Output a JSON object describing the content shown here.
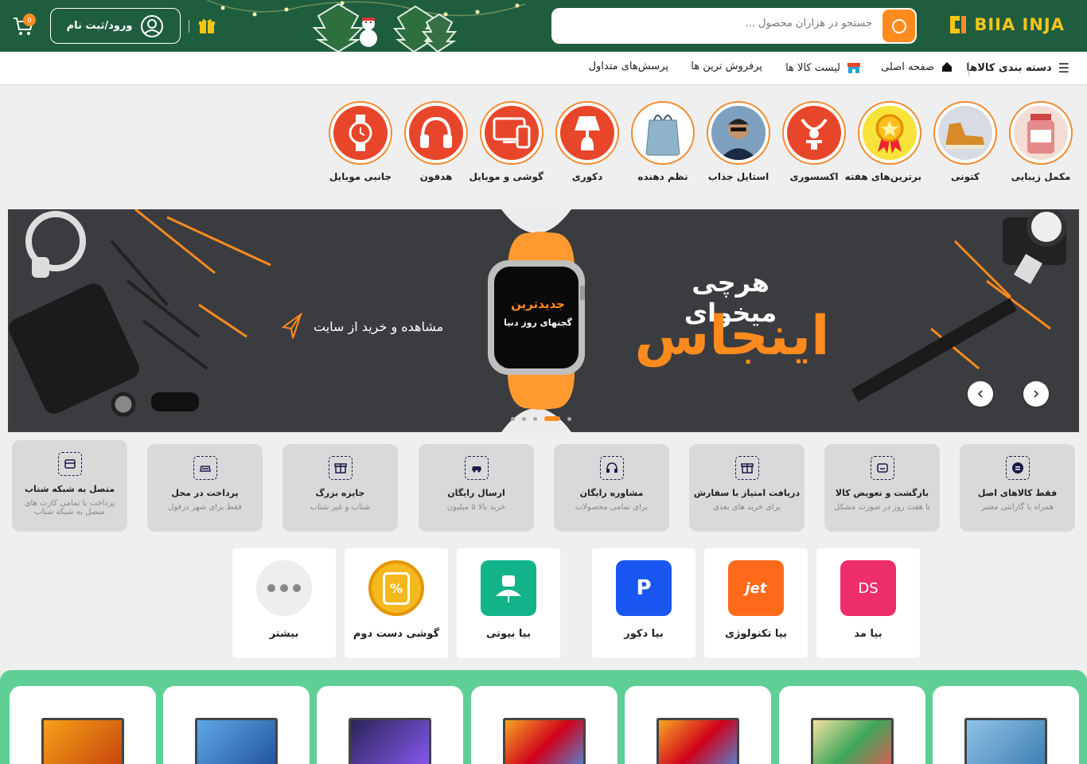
{
  "header": {
    "logo_text": "BIIA INJA",
    "search_placeholder": "جستجو در هزاران محصول ...",
    "login_label": "ورود/ثبت نام",
    "cart_count": "0"
  },
  "nav": {
    "categories": "دسته بندی کالاها",
    "home": "صفحه اصلی",
    "product_list": "لیست کالا ها",
    "bestsellers": "پرفروش ترین ها",
    "faq": "پرسش‌های متداول"
  },
  "categories": [
    {
      "label": "مکمل زیبایی",
      "icon": "supplement-bottle-icon"
    },
    {
      "label": "کتونی",
      "icon": "sneakers-icon"
    },
    {
      "label": "برترین‌های هفته",
      "icon": "top-medal-icon"
    },
    {
      "label": "اکسسوری",
      "icon": "necklace-icon"
    },
    {
      "label": "استایل جذاب",
      "icon": "model-photo-icon"
    },
    {
      "label": "نظم دهنده",
      "icon": "organizer-bag-icon"
    },
    {
      "label": "دکوری",
      "icon": "lamp-icon"
    },
    {
      "label": "گوشی و موبایل",
      "icon": "devices-icon"
    },
    {
      "label": "هدفون",
      "icon": "headphone-icon"
    },
    {
      "label": "جانبی موبایل",
      "icon": "smartwatch-icon"
    }
  ],
  "banner": {
    "headline": "هرچی میخوای",
    "highlight": "اینجاس",
    "cta": "مشاهده و خرید از سایت",
    "watch_line1": "جدیدترین",
    "watch_line2": "گجتهای روز دنیا",
    "slides": 5,
    "active_slide": 4
  },
  "features": [
    {
      "title": "فقط کالاهای اصل",
      "sub": "همراه با گارانتی معتبر",
      "icon": "original-badge-icon"
    },
    {
      "title": "بازگشت و تعویض کالا",
      "sub": "تا هفت روز در صورت مشکل",
      "icon": "return-box-icon"
    },
    {
      "title": "دریافت امتیاز با سفارش",
      "sub": "برای خرید های بعدی",
      "icon": "points-gift-icon"
    },
    {
      "title": "مشاوره رایگان",
      "sub": "برای تمامی محصولات",
      "icon": "headset-icon"
    },
    {
      "title": "ارسال رایگان",
      "sub": "خرید بالا ۵ میلیون",
      "icon": "delivery-car-icon"
    },
    {
      "title": "جایزه بزرگ",
      "sub": "شتاب و غیر شتاب",
      "icon": "grand-prize-icon"
    },
    {
      "title": "پرداخت در محل",
      "sub": "فقط برای شهر دزفول",
      "icon": "cash-on-delivery-icon"
    },
    {
      "title": "متصل به شبکه شتاب",
      "sub": "پرداخت با تمامی کارت های متصل به شبکه شتاب",
      "icon": "bank-card-icon"
    }
  ],
  "services": [
    {
      "label": "بیا مد",
      "color": "#ee2d6b",
      "icon": "bia-mod-icon",
      "mark": "DS"
    },
    {
      "label": "بیا تکنولوژی",
      "color": "#ff6a1a",
      "icon": "bia-tech-icon",
      "mark": "jet"
    },
    {
      "label": "بیا دکور",
      "color": "#1a56f0",
      "icon": "bia-decor-icon",
      "mark": "P"
    },
    {
      "label": "بیا بیوتی",
      "color": "#12b389",
      "icon": "bia-beauty-icon",
      "mark": ""
    },
    {
      "label": "گوشی دست دوم",
      "color": "#f5b81e",
      "icon": "used-phone-icon",
      "mark": "%"
    },
    {
      "label": "بیشتر",
      "color": "#eeeeee",
      "icon": "more-dots-icon",
      "mark": ""
    }
  ],
  "colors": {
    "header_bg": "#1f5d3f",
    "accent": "#ff8a1e",
    "category_red": "#e8462a",
    "promo_green": "#5fcf96"
  }
}
